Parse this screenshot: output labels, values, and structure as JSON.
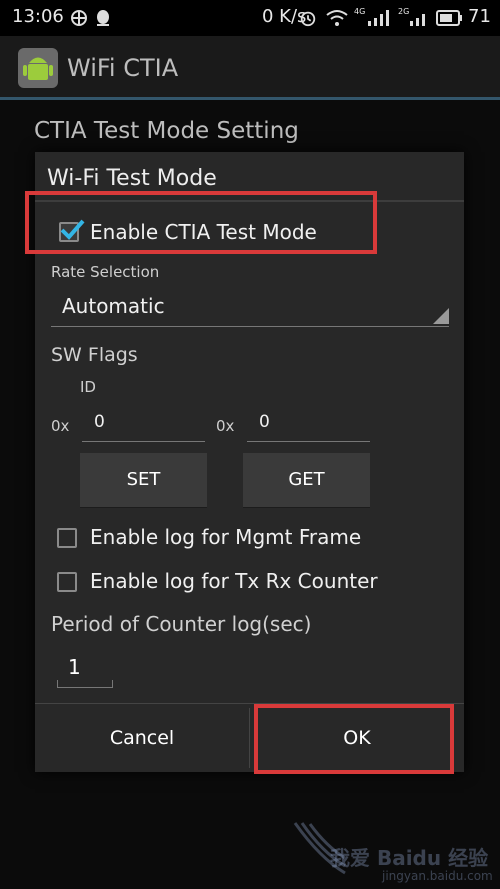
{
  "status_bar": {
    "time": "13:06",
    "speed": "0 K/s",
    "network_4g": "4G",
    "network_2g": "2G",
    "battery": "71"
  },
  "app": {
    "title": "WiFi CTIA",
    "icon": "android-app-icon"
  },
  "preference": {
    "title": "CTIA Test Mode Setting"
  },
  "dialog": {
    "title": "Wi-Fi Test Mode",
    "enable_ctia": {
      "label": "Enable CTIA Test Mode",
      "checked": true
    },
    "rate_selection_label": "Rate Selection",
    "rate_value": "Automatic",
    "sw_flags_label": "SW Flags",
    "id_label": "ID",
    "hex_prefix": "0x",
    "set_value": "0",
    "get_value": "0",
    "set_button": "SET",
    "get_button": "GET",
    "log_mgmt": {
      "label": "Enable log for Mgmt Frame",
      "checked": false
    },
    "log_txrx": {
      "label": "Enable log for Tx Rx Counter",
      "checked": false
    },
    "period_label": "Period of Counter log(sec)",
    "period_value": "1",
    "cancel_button": "Cancel",
    "ok_button": "OK"
  },
  "watermark": {
    "text": "我爱 Baidu 经验",
    "url": "jingyan.baidu.com"
  },
  "colors": {
    "accent": "#33b5e5",
    "annotation": "#d93a3a",
    "dialog_bg": "#282828"
  }
}
